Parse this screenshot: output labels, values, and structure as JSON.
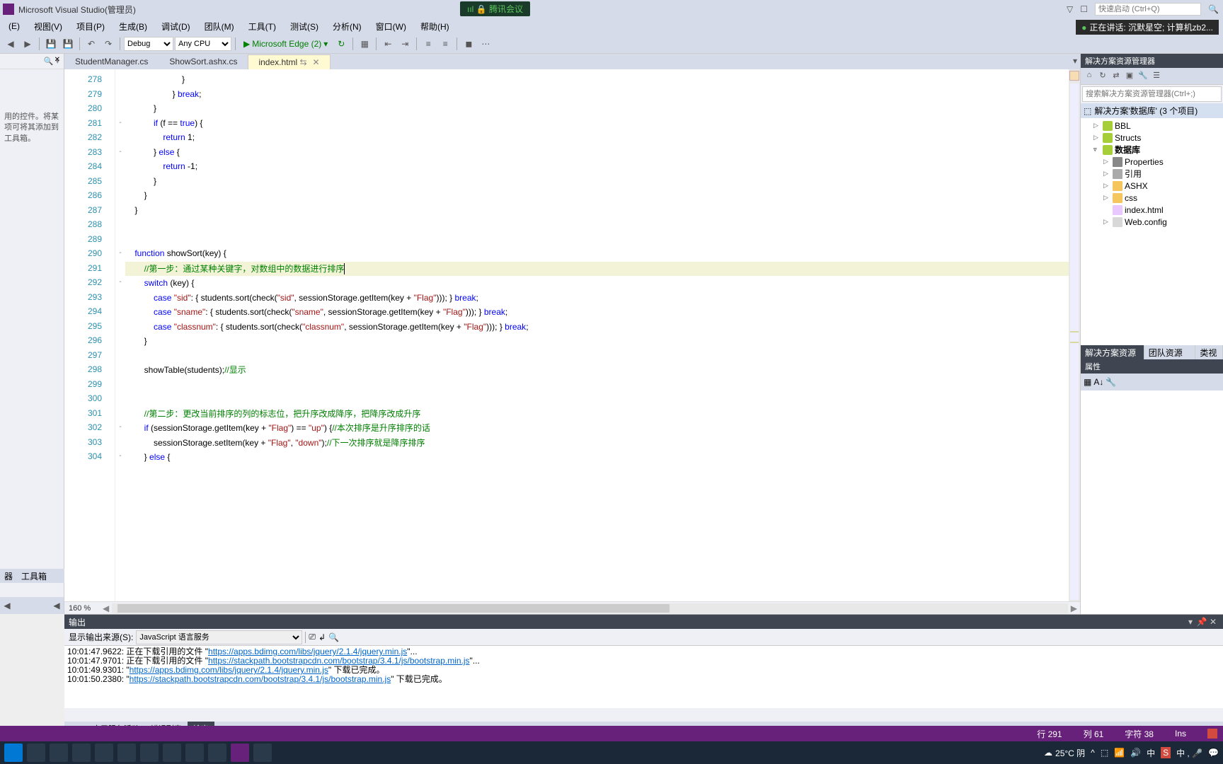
{
  "title": "Microsoft Visual Studio(管理员)",
  "meeting_badge": "腾讯会议",
  "quick_launch_placeholder": "快速启动 (Ctrl+Q)",
  "speaking": "正在讲话: 沉默星空; 计算机zb2...",
  "menu": [
    "(E)",
    "视图(V)",
    "项目(P)",
    "生成(B)",
    "调试(D)",
    "团队(M)",
    "工具(T)",
    "测试(S)",
    "分析(N)",
    "窗口(W)",
    "帮助(H)"
  ],
  "toolbar": {
    "config": "Debug",
    "platform": "Any CPU",
    "run_label": "Microsoft Edge (2)"
  },
  "left_panel": {
    "hint": "用的控件。将某项可将其添加到工具箱。",
    "bottom_tabs": [
      "器",
      "工具箱"
    ]
  },
  "tabs": [
    {
      "label": "StudentManager.cs",
      "active": false
    },
    {
      "label": "ShowSort.ashx.cs",
      "active": false
    },
    {
      "label": "index.html",
      "active": true
    }
  ],
  "code": {
    "first_line": 278,
    "zoom": "160 %",
    "lines": [
      {
        "n": 278,
        "html": "                        }"
      },
      {
        "n": 279,
        "html": "                    } <span class='kw'>break</span>;"
      },
      {
        "n": 280,
        "html": "            }"
      },
      {
        "n": 281,
        "html": "            <span class='kw'>if</span> (f == <span class='kw'>true</span>) {",
        "fold": "-"
      },
      {
        "n": 282,
        "html": "                <span class='kw'>return</span> 1;"
      },
      {
        "n": 283,
        "html": "            } <span class='kw'>else</span> {",
        "fold": "-"
      },
      {
        "n": 284,
        "html": "                <span class='kw'>return</span> -1;"
      },
      {
        "n": 285,
        "html": "            }"
      },
      {
        "n": 286,
        "html": "        }"
      },
      {
        "n": 287,
        "html": "    }"
      },
      {
        "n": 288,
        "html": ""
      },
      {
        "n": 289,
        "html": ""
      },
      {
        "n": 290,
        "html": "    <span class='kw'>function</span> showSort(key) {",
        "fold": "-"
      },
      {
        "n": 291,
        "html": "        <span class='cmt'>//第一步：通过某种关键字，对数组中的数据进行排序</span>",
        "hl": true,
        "cursor": 74
      },
      {
        "n": 292,
        "html": "        <span class='kw'>switch</span> (key) {",
        "fold": "-"
      },
      {
        "n": 293,
        "html": "            <span class='kw'>case</span> <span class='str'>\"sid\"</span>: { students.sort(check(<span class='str'>\"sid\"</span>, sessionStorage.getItem(key + <span class='str'>\"Flag\"</span>))); } <span class='kw'>break</span>;"
      },
      {
        "n": 294,
        "html": "            <span class='kw'>case</span> <span class='str'>\"sname\"</span>: { students.sort(check(<span class='str'>\"sname\"</span>, sessionStorage.getItem(key + <span class='str'>\"Flag\"</span>))); } <span class='kw'>break</span>;"
      },
      {
        "n": 295,
        "html": "            <span class='kw'>case</span> <span class='str'>\"classnum\"</span>: { students.sort(check(<span class='str'>\"classnum\"</span>, sessionStorage.getItem(key + <span class='str'>\"Flag\"</span>))); } <span class='kw'>break</span>;"
      },
      {
        "n": 296,
        "html": "        }"
      },
      {
        "n": 297,
        "html": ""
      },
      {
        "n": 298,
        "html": "        showTable(students);<span class='cmt'>//显示</span>"
      },
      {
        "n": 299,
        "html": ""
      },
      {
        "n": 300,
        "html": ""
      },
      {
        "n": 301,
        "html": "        <span class='cmt'>//第二步：更改当前排序的列的标志位，把升序改成降序，把降序改成升序</span>"
      },
      {
        "n": 302,
        "html": "        <span class='kw'>if</span> (sessionStorage.getItem(key + <span class='str'>\"Flag\"</span>) == <span class='str'>\"up\"</span>) {<span class='cmt'>//本次排序是升序排序的话</span>",
        "fold": "-"
      },
      {
        "n": 303,
        "html": "            sessionStorage.setItem(key + <span class='str'>\"Flag\"</span>, <span class='str'>\"down\"</span>);<span class='cmt'>//下一次排序就是降序排序</span>"
      },
      {
        "n": 304,
        "html": "        } <span class='kw'>else</span> {",
        "fold": "-"
      }
    ]
  },
  "solution": {
    "title": "解决方案资源管理器",
    "search_placeholder": "搜索解决方案资源管理器(Ctrl+;)",
    "root": "解决方案'数据库' (3 个项目)",
    "nodes": [
      {
        "depth": 1,
        "exp": "▷",
        "ico": "ico-cs",
        "label": "BBL"
      },
      {
        "depth": 1,
        "exp": "▷",
        "ico": "ico-cs",
        "label": "Structs"
      },
      {
        "depth": 1,
        "exp": "▿",
        "ico": "ico-cs",
        "label": "数据库",
        "bold": true
      },
      {
        "depth": 2,
        "exp": "▷",
        "ico": "ico-prop",
        "label": "Properties"
      },
      {
        "depth": 2,
        "exp": "▷",
        "ico": "ico-ref",
        "label": "引用"
      },
      {
        "depth": 2,
        "exp": "▷",
        "ico": "ico-fld",
        "label": "ASHX"
      },
      {
        "depth": 2,
        "exp": "▷",
        "ico": "ico-fld",
        "label": "css"
      },
      {
        "depth": 2,
        "exp": "",
        "ico": "ico-html",
        "label": "index.html"
      },
      {
        "depth": 2,
        "exp": "▷",
        "ico": "ico-cfg",
        "label": "Web.config"
      }
    ],
    "right_tabs": [
      "解决方案资源管理器",
      "团队资源管理器",
      "类视图"
    ]
  },
  "properties_title": "属性",
  "output": {
    "title": "输出",
    "source_label": "显示输出来源(S):",
    "source_value": "JavaScript 语言服务",
    "lines_html": [
      "10:01:47.9622: 正在下载引用的文件 \"<a>https://apps.bdimg.com/libs/jquery/2.1.4/jquery.min.js</a>\"...",
      "10:01:47.9701: 正在下载引用的文件 \"<a>https://stackpath.bootstrapcdn.com/bootstrap/3.4.1/js/bootstrap.min.js</a>\"...",
      "10:01:49.9301: \"<a>https://apps.bdimg.com/libs/jquery/2.1.4/jquery.min.js</a>\" 下载已完成。",
      "10:01:50.2380: \"<a>https://stackpath.bootstrapcdn.com/bootstrap/3.4.1/js/bootstrap.min.js</a>\" 下载已完成。"
    ]
  },
  "bottom_tabs": [
    "Azure 应用服务活动",
    "错误列表",
    "输出"
  ],
  "status": {
    "line": "行 291",
    "col": "列 61",
    "char": "字符 38",
    "ins": "Ins"
  },
  "taskbar": {
    "weather": "25°C 阴",
    "ime": "中"
  }
}
